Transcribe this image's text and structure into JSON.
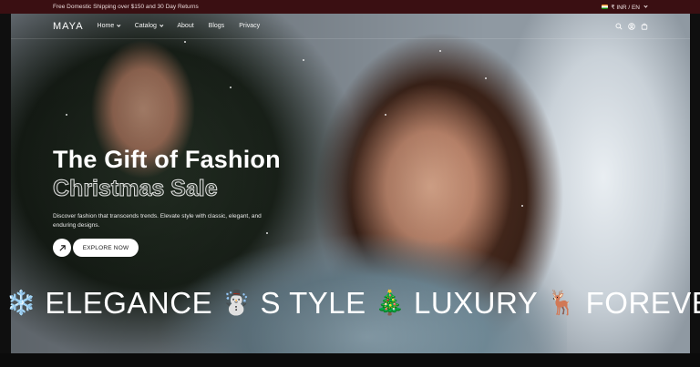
{
  "announcement": {
    "text": "Free Domestic Shipping over $150 and 30 Day Returns",
    "locale": "₹ INR / EN"
  },
  "nav": {
    "logo": "MAYA",
    "items": [
      {
        "label": "Home",
        "has_dropdown": true
      },
      {
        "label": "Catalog",
        "has_dropdown": true
      },
      {
        "label": "About",
        "has_dropdown": false
      },
      {
        "label": "Blogs",
        "has_dropdown": false
      },
      {
        "label": "Privacy",
        "has_dropdown": false
      }
    ],
    "icons": [
      "search-icon",
      "account-icon",
      "cart-icon"
    ]
  },
  "hero": {
    "title": "The Gift of Fashion",
    "subtitle": "Christmas Sale",
    "description": "Discover fashion that transcends trends. Elevate style with classic, elegant, and enduring designs.",
    "cta_label": "EXPLORE NOW"
  },
  "marquee": {
    "items": [
      {
        "emoji": "❄️",
        "word": "ELEGANCE"
      },
      {
        "emoji": "☃️",
        "word": "S TYLE"
      },
      {
        "emoji": "🎄",
        "word": "LUXURY"
      },
      {
        "emoji": "🦌",
        "word": "FOREVER"
      }
    ]
  },
  "colors": {
    "announcement_bg": "#3a0f12",
    "button_bg": "#ffffff",
    "text": "#ffffff"
  }
}
